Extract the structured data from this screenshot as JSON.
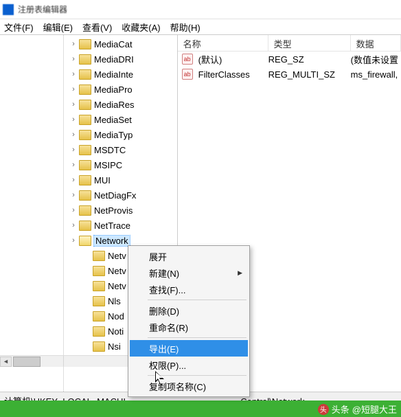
{
  "window": {
    "title": "注册表编辑器"
  },
  "menu": {
    "file": "文件(F)",
    "edit": "编辑(E)",
    "view": "查看(V)",
    "favorites": "收藏夹(A)",
    "help": "帮助(H)"
  },
  "tree": {
    "items": [
      "MediaCat",
      "MediaDRI",
      "MediaInte",
      "MediaPro",
      "MediaRes",
      "MediaSet",
      "MediaTyp",
      "MSDTC",
      "MSIPC",
      "MUI",
      "NetDiagFx",
      "NetProvis",
      "NetTrace",
      "Network",
      "Netv",
      "Netv",
      "Netv",
      "Nls",
      "Nod",
      "Noti",
      "Nsi"
    ],
    "selected_index": 13
  },
  "list": {
    "headers": {
      "name": "名称",
      "type": "类型",
      "data": "数据"
    },
    "rows": [
      {
        "icon": "ab",
        "name": "(默认)",
        "type": "REG_SZ",
        "data": "(数值未设置"
      },
      {
        "icon": "ab",
        "name": "FilterClasses",
        "type": "REG_MULTI_SZ",
        "data": "ms_firewall,"
      }
    ]
  },
  "context_menu": {
    "expand": "展开",
    "new": "新建(N)",
    "find": "查找(F)...",
    "delete": "删除(D)",
    "rename": "重命名(R)",
    "export": "导出(E)",
    "permissions": "权限(P)...",
    "copykey": "复制项名称(C)"
  },
  "statusbar": {
    "left": "计算机\\HKEY_LOCAL_MACHI",
    "right": "Control\\Network"
  },
  "watermark": {
    "prefix": "头条",
    "author": "@短腿大王"
  }
}
